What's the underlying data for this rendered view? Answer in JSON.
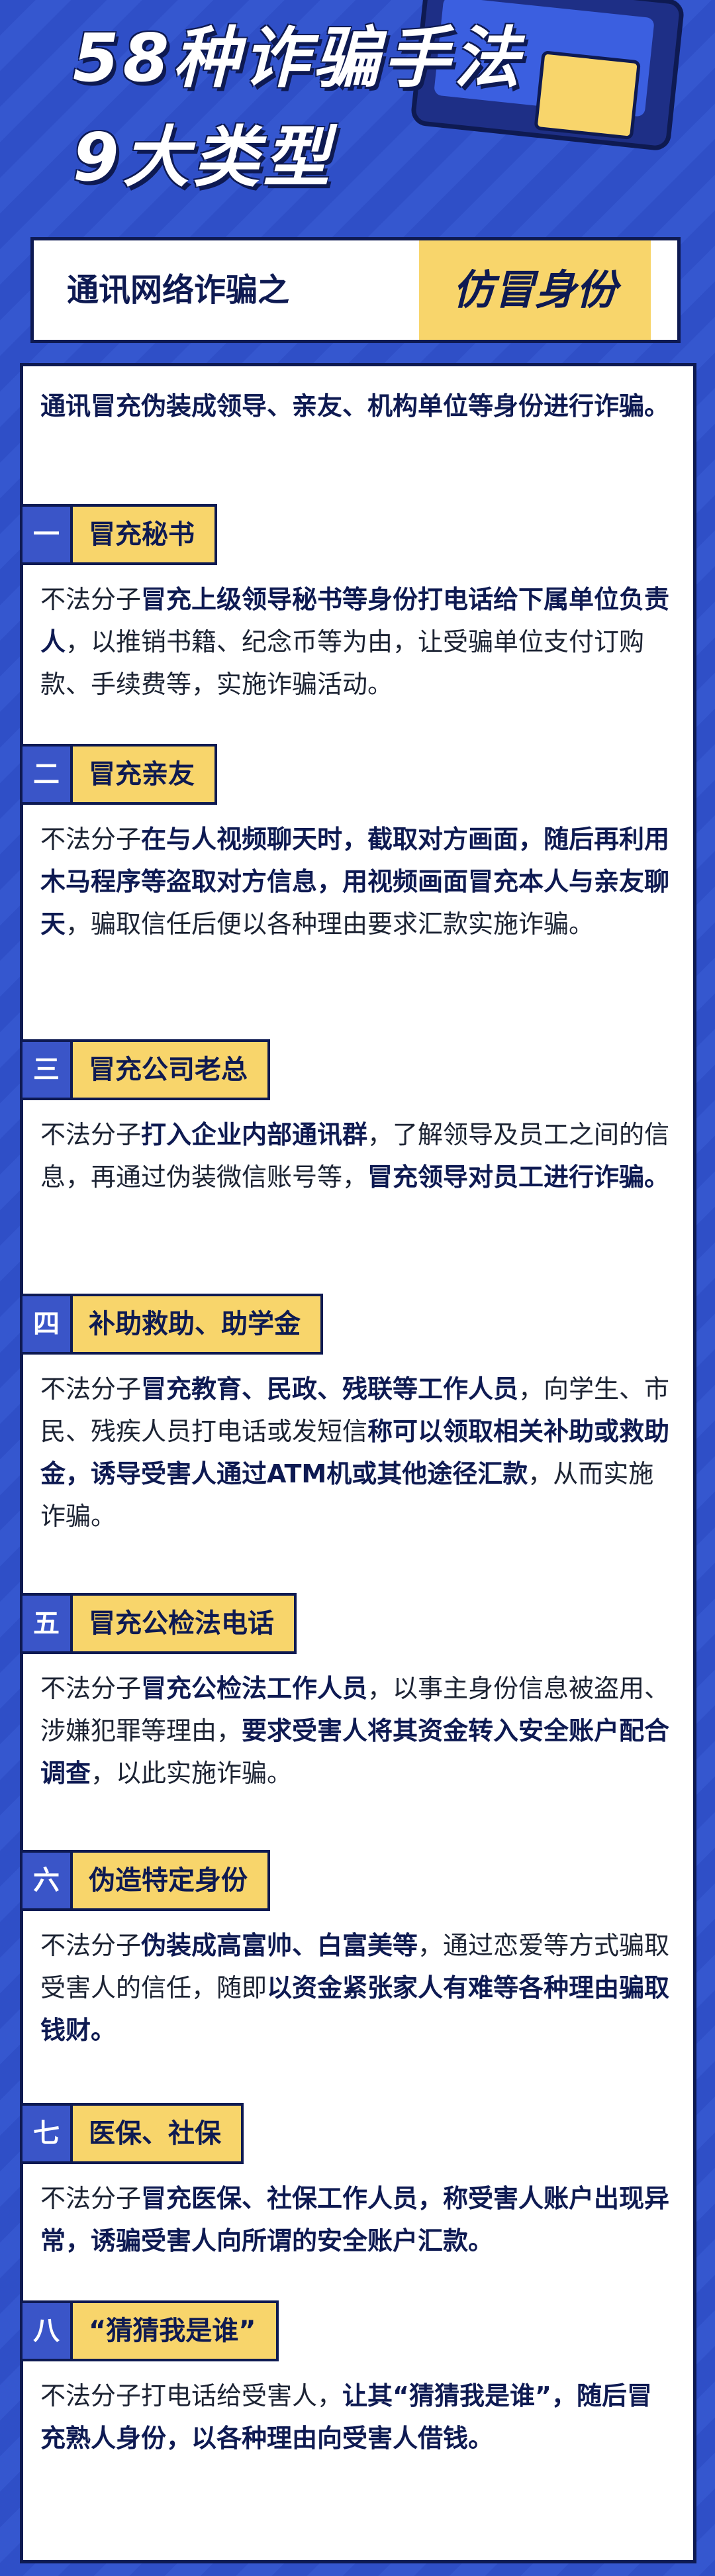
{
  "header": {
    "title_line1": "58种诈骗手法",
    "title_line2": "9大类型"
  },
  "topic": {
    "prefix": "通讯网络诈骗之",
    "highlight": "仿冒身份"
  },
  "intro": "通讯冒充伪装成领导、亲友、机构单位等身份进行诈骗。",
  "sections": [
    {
      "num": "一",
      "title": "冒充秘书",
      "body": [
        {
          "t": "不法分子",
          "b": false
        },
        {
          "t": "冒充上级领导秘书等身份打电话给下属单位负责人",
          "b": true
        },
        {
          "t": "，以推销书籍、纪念币等为由，让受骗单位支付订购款、手续费等，实施诈骗活动。",
          "b": false
        }
      ]
    },
    {
      "num": "二",
      "title": "冒充亲友",
      "body": [
        {
          "t": "不法分子",
          "b": false
        },
        {
          "t": "在与人视频聊天时，截取对方画面，随后再利用木马程序等盗取对方信息，用视频画面冒充本人与亲友聊天",
          "b": true
        },
        {
          "t": "，骗取信任后便以各种理由要求汇款实施诈骗。",
          "b": false
        }
      ]
    },
    {
      "num": "三",
      "title": "冒充公司老总",
      "body": [
        {
          "t": "不法分子",
          "b": false
        },
        {
          "t": "打入企业内部通讯群",
          "b": true
        },
        {
          "t": "，了解领导及员工之间的信息，再通过伪装微信账号等，",
          "b": false
        },
        {
          "t": "冒充领导对员工进行诈骗。",
          "b": true
        }
      ]
    },
    {
      "num": "四",
      "title": "补助救助、助学金",
      "body": [
        {
          "t": "不法分子",
          "b": false
        },
        {
          "t": "冒充教育、民政、残联等工作人员",
          "b": true
        },
        {
          "t": "，向学生、市民、残疾人员打电话或发短信",
          "b": false
        },
        {
          "t": "称可以领取相关补助或救助金，诱导受害人通过ATM机或其他途径汇款",
          "b": true
        },
        {
          "t": "，从而实施诈骗。",
          "b": false
        }
      ]
    },
    {
      "num": "五",
      "title": "冒充公检法电话",
      "body": [
        {
          "t": "不法分子",
          "b": false
        },
        {
          "t": "冒充公检法工作人员",
          "b": true
        },
        {
          "t": "，以事主身份信息被盗用、涉嫌犯罪等理由，",
          "b": false
        },
        {
          "t": "要求受害人将其资金转入安全账户配合调查",
          "b": true
        },
        {
          "t": "，以此实施诈骗。",
          "b": false
        }
      ]
    },
    {
      "num": "六",
      "title": "伪造特定身份",
      "body": [
        {
          "t": "不法分子",
          "b": false
        },
        {
          "t": "伪装成高富帅、白富美等",
          "b": true
        },
        {
          "t": "，通过恋爱等方式骗取受害人的信任，随即",
          "b": false
        },
        {
          "t": "以资金紧张家人有难等各种理由骗取钱财。",
          "b": true
        }
      ]
    },
    {
      "num": "七",
      "title": "医保、社保",
      "body": [
        {
          "t": "不法分子",
          "b": false
        },
        {
          "t": "冒充医保、社保工作人员，称受害人账户出现异常，诱骗受害人向所谓的安全账户汇款。",
          "b": true
        }
      ]
    },
    {
      "num": "八",
      "title": "“猜猜我是谁”",
      "body": [
        {
          "t": "不法分子打电话给受害人，",
          "b": false
        },
        {
          "t": "让其“猜猜我是谁”，随后冒充熟人身份，以各种理由向受害人借钱。",
          "b": true
        }
      ]
    }
  ],
  "colors": {
    "background": "#2f4fc7",
    "navy": "#0e1a52",
    "accent_yellow": "#f8d56b",
    "number_box": "#3a55c8"
  }
}
